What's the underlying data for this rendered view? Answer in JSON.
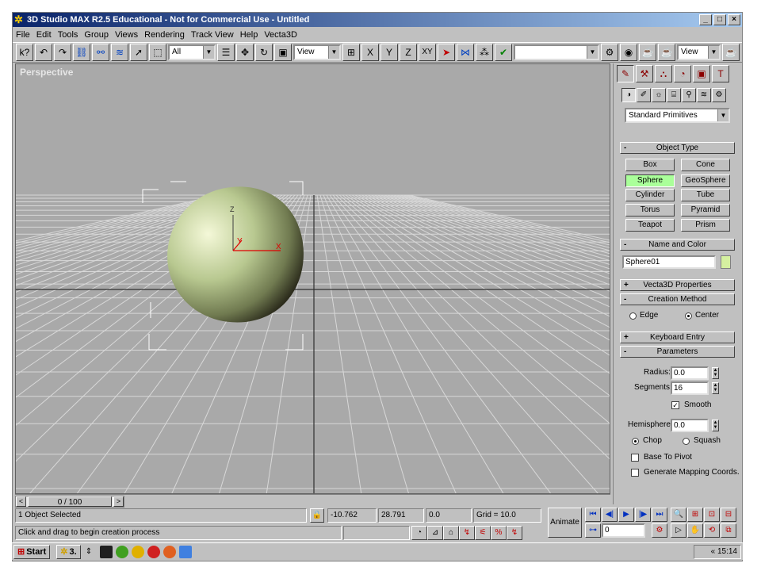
{
  "window": {
    "title": "3D Studio MAX R2.5 Educational - Not for Commercial Use - Untitled",
    "controls": [
      "_",
      "□",
      "×"
    ]
  },
  "menu": [
    "File",
    "Edit",
    "Tools",
    "Group",
    "Views",
    "Rendering",
    "Track View",
    "Help",
    "Vecta3D"
  ],
  "toolbar": {
    "selection_filter": "All",
    "ref_coord": "View",
    "axis_x": "X",
    "axis_y": "Y",
    "axis_z": "Z",
    "axis_xy": "XY",
    "named_sel": "",
    "render_view": "View"
  },
  "viewport": {
    "label": "Perspective",
    "gizmo": {
      "z_label": "Z",
      "y_label": "Y",
      "x_label": "X"
    },
    "colors": {
      "background": "#a9a9a9",
      "grid": "#d8d8d8",
      "sphere_light": "#f0f6d0",
      "sphere_mid": "#b8c890",
      "sphere_dark": "#2c2c1c"
    }
  },
  "timeline": {
    "frame": "0 / 100"
  },
  "command_panel": {
    "category": "Standard Primitives",
    "object_type": {
      "header": "Object Type",
      "buttons": [
        "Box",
        "Cone",
        "Sphere",
        "GeoSphere",
        "Cylinder",
        "Tube",
        "Torus",
        "Pyramid",
        "Teapot",
        "Prism"
      ],
      "active": "Sphere"
    },
    "name_color": {
      "header": "Name and Color",
      "name": "Sphere01",
      "color": "#d5f0a0"
    },
    "vecta3d": {
      "header": "Vecta3D Properties"
    },
    "creation_method": {
      "header": "Creation Method",
      "edge": "Edge",
      "center": "Center"
    },
    "keyboard_entry": {
      "header": "Keyboard Entry"
    },
    "parameters": {
      "header": "Parameters",
      "radius_label": "Radius:",
      "radius": "0.0",
      "segments_label": "Segments:",
      "segments": "16",
      "smooth": "Smooth",
      "hemisphere_label": "Hemisphere:",
      "hemisphere": "0.0",
      "chop": "Chop",
      "squash": "Squash",
      "base_to_pivot": "Base To Pivot",
      "gen_mapping": "Generate Mapping Coords."
    }
  },
  "status": {
    "selected": "1 Object Selected",
    "prompt": "Click and drag to begin creation process",
    "x": "-10.762",
    "y": "28.791",
    "z": "0.0",
    "grid": "Grid = 10.0",
    "animate": "Animate",
    "frame": "0"
  },
  "taskbar": {
    "start": "Start",
    "task": "3.",
    "clock": "15:14",
    "tray_arrow": "«"
  }
}
